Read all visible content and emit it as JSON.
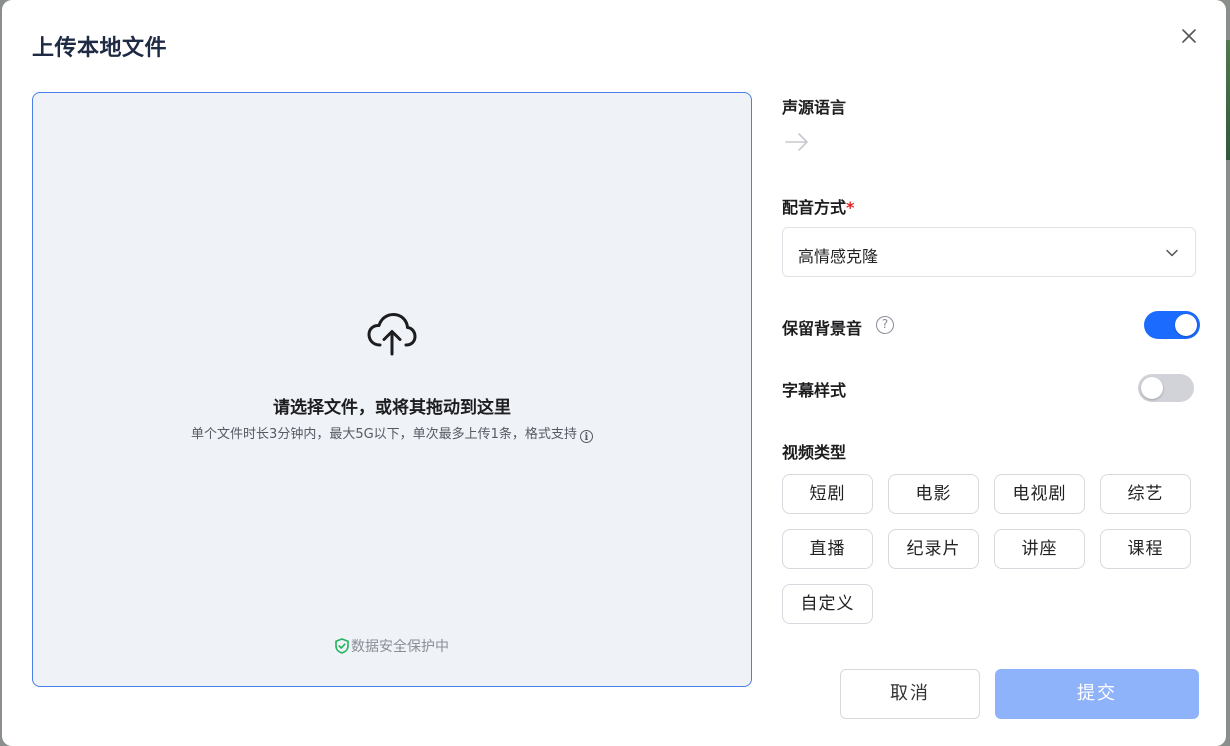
{
  "dialog": {
    "title": "上传本地文件"
  },
  "upload": {
    "title": "请选择文件，或将其拖动到这里",
    "hint": "单个文件时长3分钟内，最大5G以下，单次最多上传1条，格式支持",
    "security_note": "数据安全保护中"
  },
  "form": {
    "source_language_label": "声源语言",
    "dubbing_method_label": "配音方式",
    "required_mark": "*",
    "dubbing_method_value": "高情感克隆",
    "keep_bgm_label": "保留背景音",
    "keep_bgm_help": "?",
    "keep_bgm_on": true,
    "subtitle_style_label": "字幕样式",
    "subtitle_style_on": false,
    "video_type_label": "视频类型",
    "video_types": [
      "短剧",
      "电影",
      "电视剧",
      "综艺",
      "直播",
      "纪录片",
      "讲座",
      "课程",
      "自定义"
    ]
  },
  "actions": {
    "cancel_label": "取消",
    "submit_label": "提交"
  },
  "colors": {
    "accent": "#1c6bff",
    "submit_disabled": "#8fb3fb",
    "upload_border": "#4a7fe8",
    "required": "#e02424",
    "shield": "#22b35e"
  },
  "icons": {
    "close": "close-icon",
    "upload": "cloud-upload-icon",
    "info": "info-icon",
    "shield": "shield-check-icon",
    "arrow": "arrow-right-icon",
    "chevron": "chevron-down-icon",
    "help": "question-circle-icon"
  }
}
